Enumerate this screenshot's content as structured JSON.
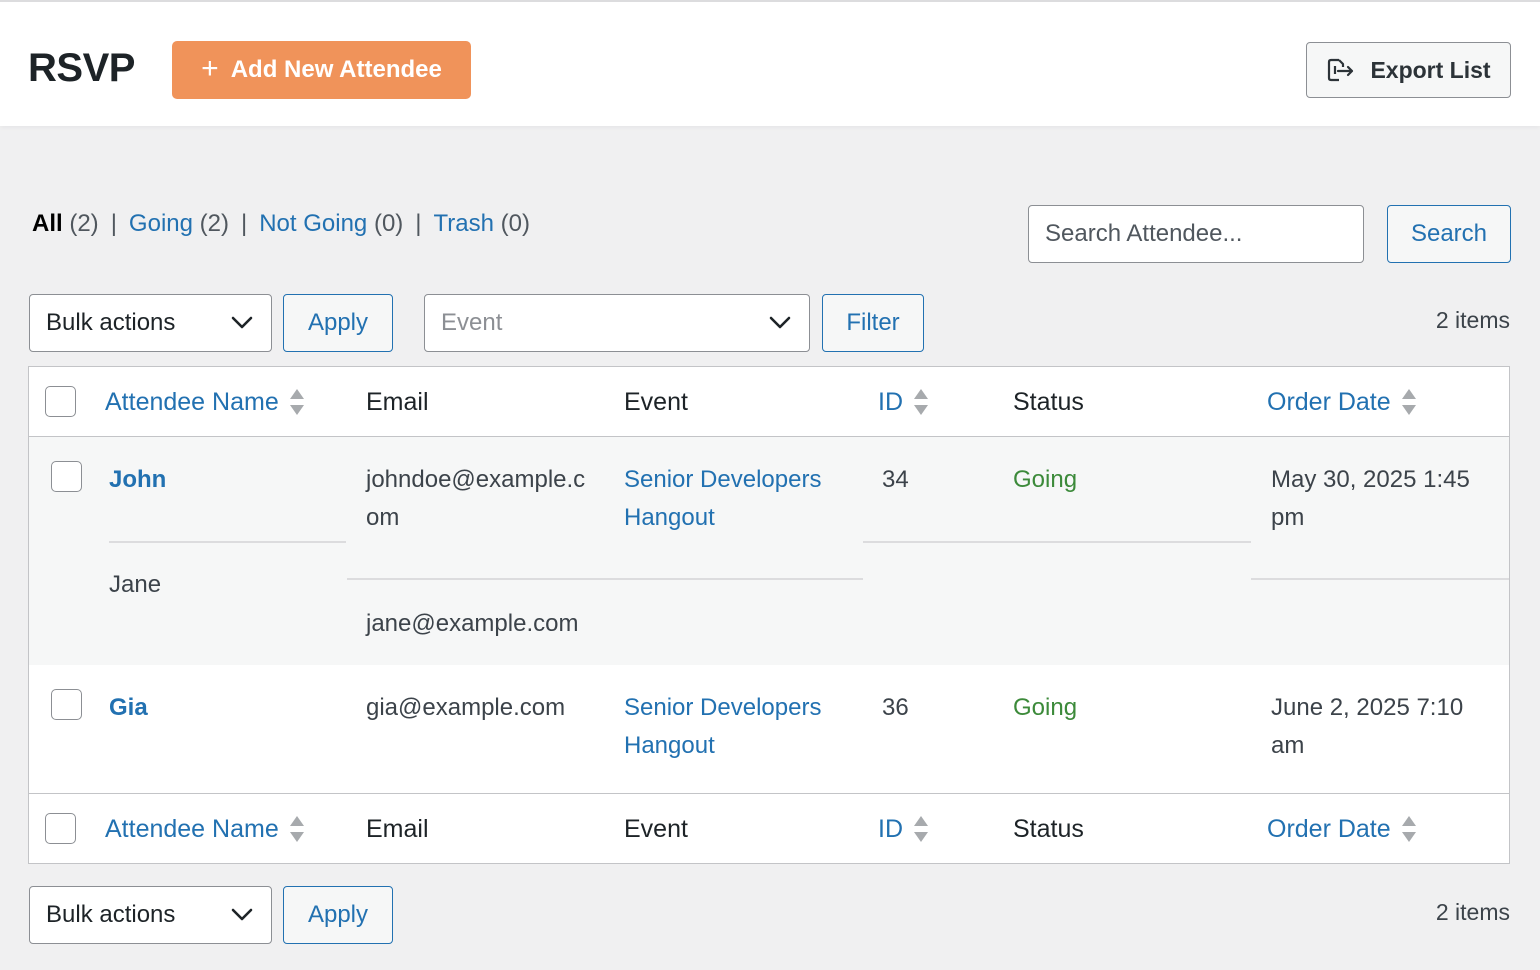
{
  "header": {
    "title": "RSVP",
    "add_button": "Add New Attendee",
    "export_button": "Export List"
  },
  "icons": {
    "add": "plus-icon",
    "export": "export-icon",
    "dropdown": "chevron-down-icon",
    "sort": "sort-arrows-icon"
  },
  "colors": {
    "accent": "#f0935a",
    "link": "#2271b1",
    "going": "#3c8a3a"
  },
  "filters": {
    "all_label": "All",
    "all_count": "(2)",
    "going_label": "Going",
    "going_count": "(2)",
    "not_going_label": "Not Going",
    "not_going_count": "(0)",
    "trash_label": "Trash",
    "trash_count": "(0)",
    "separator": "|"
  },
  "search": {
    "placeholder": "Search Attendee...",
    "button": "Search"
  },
  "toolbar_top": {
    "bulk_actions": "Bulk actions",
    "apply": "Apply",
    "event_placeholder": "Event",
    "filter": "Filter",
    "items": "2 items"
  },
  "toolbar_bottom": {
    "bulk_actions": "Bulk actions",
    "apply": "Apply",
    "items": "2 items"
  },
  "columns": {
    "name": "Attendee Name",
    "email": "Email",
    "event": "Event",
    "id": "ID",
    "status": "Status",
    "order_date": "Order Date"
  },
  "rows": [
    {
      "name": "John",
      "email_line1": "johndoe@example.c",
      "email_line2": "om",
      "event_line1": "Senior Developers",
      "event_line2": "Hangout",
      "id": "34",
      "status": "Going",
      "date_line1": "May 30, 2025 1:45",
      "date_line2": "pm",
      "guest_name": "Jane",
      "guest_email": "jane@example.com"
    },
    {
      "name": "Gia",
      "email": "gia@example.com",
      "event_line1": "Senior Developers",
      "event_line2": "Hangout",
      "id": "36",
      "status": "Going",
      "date_line1": "June 2, 2025 7:10",
      "date_line2": "am"
    }
  ]
}
